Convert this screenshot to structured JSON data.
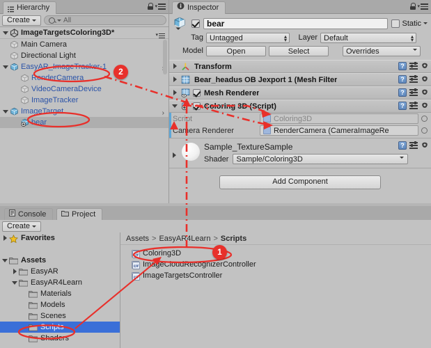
{
  "colors": {
    "panel_bg": "#c2c2c2",
    "tab_bar": "#a9a9a9",
    "selection_blue": "#3a6fd8",
    "selection_gray": "#aeaeae",
    "annotation_red": "#e8302b",
    "prefab_blue": "#5fa8d8",
    "hierarchy_link": "#2b53a8"
  },
  "hierarchy": {
    "tab_label": "Hierarchy",
    "tab_icon": "hierarchy-icon",
    "lock_icon": "lock-icon",
    "menu_icon": "hamburger-menu-icon",
    "create_label": "Create",
    "search_placeholder": "All",
    "search_value": "",
    "search_icon": "search-icon",
    "scene": {
      "name": "ImageTargetsColoring3D*",
      "icon": "unity-scene-icon"
    },
    "items": [
      {
        "label": "Main Camera",
        "indent": 1,
        "icon": "gameobject-icon",
        "foldout": "none",
        "selected": false,
        "prefab_arrow": false,
        "link": false
      },
      {
        "label": "Directional Light",
        "indent": 1,
        "icon": "gameobject-icon",
        "foldout": "none",
        "selected": false,
        "prefab_arrow": false,
        "link": false
      },
      {
        "label": "EasyAR_ImageTracker-1",
        "indent": 1,
        "icon": "prefab-icon",
        "foldout": "open",
        "selected": false,
        "prefab_arrow": true,
        "link": true
      },
      {
        "label": "RenderCamera",
        "indent": 2,
        "icon": "gameobject-icon",
        "foldout": "none",
        "selected": false,
        "prefab_arrow": false,
        "link": true
      },
      {
        "label": "VideoCameraDevice",
        "indent": 2,
        "icon": "gameobject-icon",
        "foldout": "none",
        "selected": false,
        "prefab_arrow": false,
        "link": true
      },
      {
        "label": "ImageTracker",
        "indent": 2,
        "icon": "gameobject-icon",
        "foldout": "none",
        "selected": false,
        "prefab_arrow": false,
        "link": true
      },
      {
        "label": "ImageTarget",
        "indent": 1,
        "icon": "prefab-icon",
        "foldout": "open",
        "selected": false,
        "prefab_arrow": true,
        "link": true
      },
      {
        "label": "bear",
        "indent": 2,
        "icon": "model-prefab-icon",
        "foldout": "none",
        "selected": true,
        "prefab_arrow": false,
        "link": true
      }
    ]
  },
  "inspector": {
    "tab_label": "Inspector",
    "tab_icon": "inspector-info-icon",
    "lock_icon": "lock-icon",
    "menu_icon": "hamburger-menu-icon",
    "object_icon": "model-prefab-icon",
    "enabled": true,
    "name_value": "bear",
    "static_label": "Static",
    "static_checked": false,
    "static_dropdown_icon": "chevron-down-icon",
    "tag_label": "Tag",
    "tag_value": "Untagged",
    "layer_label": "Layer",
    "layer_value": "Default",
    "model_label": "Model",
    "open_label": "Open",
    "select_label": "Select",
    "overrides_label": "Overrides",
    "components": [
      {
        "title": "Transform",
        "icon": "transform-icon",
        "foldout": "closed",
        "has_checkbox": false,
        "checked": false
      },
      {
        "title": "Bear_headus OB Jexport 1 (Mesh Filter",
        "icon": "mesh-filter-icon",
        "foldout": "closed",
        "has_checkbox": false,
        "checked": false
      },
      {
        "title": "Mesh Renderer",
        "icon": "mesh-renderer-icon",
        "foldout": "closed",
        "has_checkbox": true,
        "checked": true
      },
      {
        "title": "Coloring 3D (Script)",
        "icon": "script-icon",
        "foldout": "open",
        "has_checkbox": true,
        "checked": true
      }
    ],
    "component_icons": {
      "help": "help-icon",
      "preset": "preset-icon",
      "settings": "gear-icon"
    },
    "script_fields": [
      {
        "label": "Script",
        "value": "Coloring3D",
        "disabled": true,
        "picker_icon": "object-picker-icon"
      },
      {
        "label": "Camera Renderer",
        "value": "RenderCamera (CameraImageRe",
        "disabled": false,
        "picker_icon": "object-picker-icon"
      }
    ],
    "material": {
      "name": "Sample_TextureSample",
      "preview_icon": "material-sphere-preview",
      "shader_label": "Shader",
      "shader_value": "Sample/Coloring3D"
    },
    "add_component_label": "Add Component"
  },
  "project": {
    "tabs": [
      {
        "label": "Console",
        "icon": "console-icon",
        "active": false
      },
      {
        "label": "Project",
        "icon": "folder-icon",
        "active": true
      }
    ],
    "create_label": "Create",
    "tree": [
      {
        "label": "Favorites",
        "indent": 0,
        "icon": "star-icon",
        "foldout": "closed",
        "bold": true,
        "selected": false
      },
      {
        "label": "",
        "indent": 0,
        "icon": "spacer",
        "foldout": "none",
        "bold": false,
        "selected": false
      },
      {
        "label": "Assets",
        "indent": 0,
        "icon": "folder-icon",
        "foldout": "open",
        "bold": true,
        "selected": false
      },
      {
        "label": "EasyAR",
        "indent": 1,
        "icon": "folder-icon",
        "foldout": "closed",
        "bold": false,
        "selected": false
      },
      {
        "label": "EasyAR4Learn",
        "indent": 1,
        "icon": "folder-icon",
        "foldout": "open",
        "bold": false,
        "selected": false
      },
      {
        "label": "Materials",
        "indent": 2,
        "icon": "folder-icon",
        "foldout": "none",
        "bold": false,
        "selected": false
      },
      {
        "label": "Models",
        "indent": 2,
        "icon": "folder-icon",
        "foldout": "none",
        "bold": false,
        "selected": false
      },
      {
        "label": "Scenes",
        "indent": 2,
        "icon": "folder-icon",
        "foldout": "none",
        "bold": false,
        "selected": false
      },
      {
        "label": "Scripts",
        "indent": 2,
        "icon": "folder-icon",
        "foldout": "none",
        "bold": false,
        "selected": true
      },
      {
        "label": "Shaders",
        "indent": 2,
        "icon": "folder-icon",
        "foldout": "none",
        "bold": false,
        "selected": false
      }
    ],
    "breadcrumb": [
      "Assets",
      "EasyAR4Learn",
      "Scripts"
    ],
    "assets": [
      {
        "label": "Coloring3D",
        "icon": "csharp-script-icon"
      },
      {
        "label": "ImageCloudRecognizerController",
        "icon": "csharp-script-icon"
      },
      {
        "label": "ImageTargetsController",
        "icon": "csharp-script-icon"
      }
    ]
  },
  "annotations": {
    "badges": [
      {
        "id": "1",
        "label": "1"
      },
      {
        "id": "2",
        "label": "2"
      }
    ],
    "ellipses": [
      "hierarchy-rendercamera-ellipse",
      "hierarchy-bear-ellipse",
      "project-coloring3d-ellipse",
      "project-scripts-folder-ellipse"
    ],
    "arrows": [
      "rendercamera-to-camera-renderer-field",
      "coloring3d-asset-to-script-field",
      "scripts-folder-to-coloring3d-asset"
    ]
  }
}
